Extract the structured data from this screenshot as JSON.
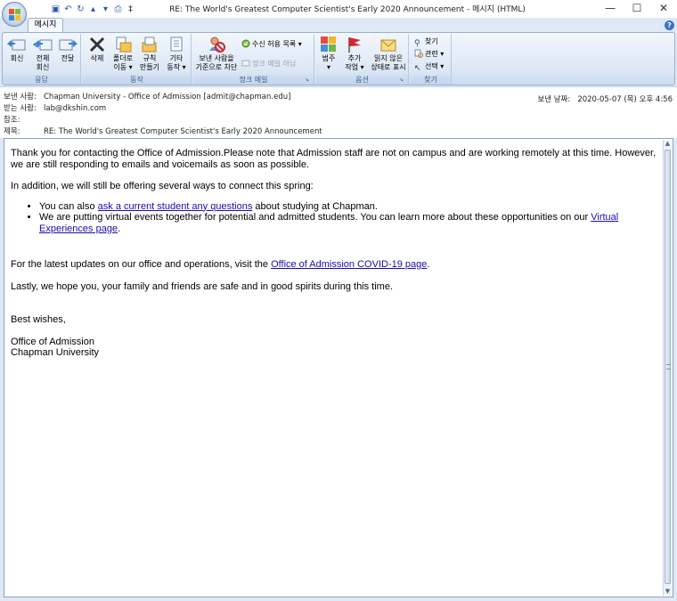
{
  "window": {
    "title": "RE: The World's Greatest Computer Scientist's Early 2020 Announcement - 메시지 (HTML)",
    "minimize_label": "—",
    "maximize_label": "☐",
    "close_label": "✕"
  },
  "ribbon": {
    "active_tab": "메시지",
    "groups": {
      "respond": {
        "label": "응답",
        "reply": [
          "회신"
        ],
        "reply_all": [
          "전체",
          "회신"
        ],
        "forward": [
          "전달"
        ]
      },
      "actions": {
        "label": "동작",
        "delete": [
          "삭제"
        ],
        "move_folder": [
          "폴더로",
          "이동 ▾"
        ],
        "create_rule": [
          "규칙",
          "만들기"
        ],
        "other_actions": [
          "기타",
          "동작 ▾"
        ]
      },
      "junk": {
        "label": "정크 메일",
        "block_sender": [
          "보낸 사람을",
          "기준으로 차단"
        ],
        "safe_list": "수신 허용 목록 ▾",
        "not_junk": "정크 메일 아님"
      },
      "options": {
        "label": "옵션",
        "categorize": [
          "범주",
          "▾"
        ],
        "follow_up": [
          "추가",
          "작업 ▾"
        ],
        "mark_unread": [
          "읽지 않은",
          "상태로 표시"
        ]
      },
      "find": {
        "label": "찾기",
        "find": "찾기",
        "related": "관련 ▾",
        "select": "선택 ▾"
      }
    }
  },
  "header": {
    "from_label": "보낸 사람:",
    "from_value": "Chapman University - Office of Admission [admit@chapman.edu]",
    "to_label": "받는 사람:",
    "to_value": "lab@dkshin.com",
    "cc_label": "참조:",
    "cc_value": "",
    "subject_label": "제목:",
    "subject_value": "RE: The World's Greatest Computer Scientist's Early 2020 Announcement",
    "sent_label": "보낸 날짜:",
    "sent_value": "2020-05-07 (목) 오후 4:56"
  },
  "body": {
    "para1": "Thank you for contacting the Office of Admission.Please note that Admission staff are not on campus and are working remotely at this time. However, we are still responding to emails and voicemails as soon as possible.",
    "para2": "In addition, we will still be offering several ways to connect this spring:",
    "bullet1_pre": "You can also ",
    "bullet1_link": "ask a current student any questions",
    "bullet1_post": " about studying at Chapman.",
    "bullet2_pre": "We are putting virtual events together for potential and admitted students. You can learn more about these opportunities on our ",
    "bullet2_link": "Virtual Experiences page",
    "bullet2_post": ".",
    "para3_pre": "For the latest updates on our office and operations, visit the ",
    "para3_link": "Office of Admission COVID-19 page",
    "para3_post": ".",
    "para4": "Lastly, we hope you, your family and friends are safe and in good spirits during this time.",
    "closing": "Best wishes,",
    "sig1": "Office of Admission",
    "sig2": "Chapman University"
  },
  "colors": {
    "ribbon_bg": "#dbe6f4",
    "link": "#1a0dab",
    "help_icon": "#3b74c4"
  }
}
